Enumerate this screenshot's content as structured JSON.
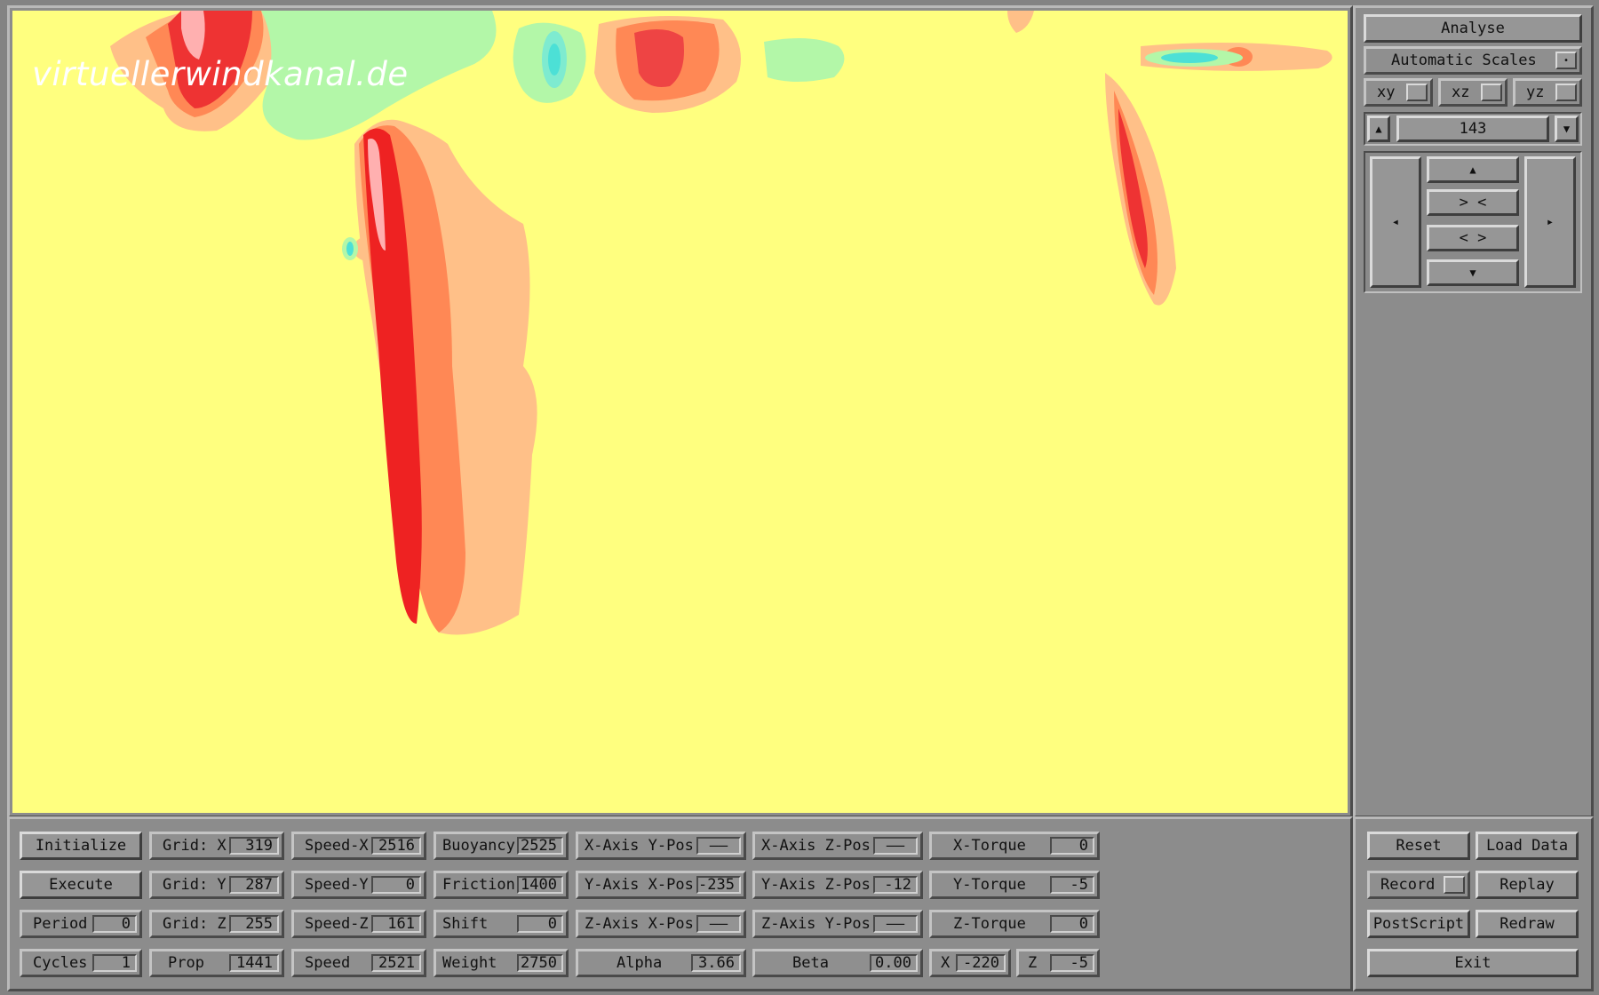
{
  "watermark": "virtuellerwindkanal.de",
  "side_panel": {
    "analyse_label": "Analyse",
    "scales_label": "Automatic Scales",
    "scales_check": "•",
    "plane_buttons": [
      "xy",
      "xz",
      "yz"
    ],
    "slice_up_glyph": "▲",
    "slice_down_glyph": "▼",
    "slice_value": "143",
    "nav": {
      "left_glyph": "◂",
      "right_glyph": "▸",
      "up_glyph": "▲",
      "zoom_in_label": "> <",
      "zoom_out_label": "< >",
      "down_glyph": "▼"
    }
  },
  "controls": {
    "initialize": "Initialize",
    "execute": "Execute",
    "period_label": "Period",
    "period_value": "0",
    "cycles_label": "Cycles",
    "cycles_value": "1",
    "grid_x_label": "Grid: X",
    "grid_x_value": "319",
    "grid_y_label": "Grid: Y",
    "grid_y_value": "287",
    "grid_z_label": "Grid: Z",
    "grid_z_value": "255",
    "prop_label": "Prop",
    "prop_value": "1441",
    "speed_x_label": "Speed-X",
    "speed_x_value": "2516",
    "speed_y_label": "Speed-Y",
    "speed_y_value": "0",
    "speed_z_label": "Speed-Z",
    "speed_z_value": "161",
    "speed_label": "Speed",
    "speed_value": "2521",
    "buoyancy_label": "Buoyancy",
    "buoyancy_value": "2525",
    "friction_label": "Friction",
    "friction_value": "1400",
    "shift_label": "Shift",
    "shift_value": "0",
    "weight_label": "Weight",
    "weight_value": "2750",
    "xaxis_ypos_label": "X-Axis Y-Pos",
    "xaxis_ypos_value": "——",
    "yaxis_xpos_label": "Y-Axis X-Pos",
    "yaxis_xpos_value": "-235",
    "zaxis_xpos_label": "Z-Axis X-Pos",
    "zaxis_xpos_value": "——",
    "alpha_label": "Alpha",
    "alpha_value": "3.66",
    "xaxis_zpos_label": "X-Axis Z-Pos",
    "xaxis_zpos_value": "——",
    "yaxis_zpos_label": "Y-Axis Z-Pos",
    "yaxis_zpos_value": "-12",
    "zaxis_ypos_label": "Z-Axis Y-Pos",
    "zaxis_ypos_value": "——",
    "beta_label": "Beta",
    "beta_value": "0.00",
    "x_torque_label": "X-Torque",
    "x_torque_value": "0",
    "y_torque_label": "Y-Torque",
    "y_torque_value": "-5",
    "z_torque_label": "Z-Torque",
    "z_torque_value": "0",
    "x_label": "X",
    "x_value": "-220",
    "z_label": "Z",
    "z_value": "-5"
  },
  "actions": {
    "reset": "Reset",
    "load_data": "Load Data",
    "record": "Record",
    "replay": "Replay",
    "postscript": "PostScript",
    "redraw": "Redraw",
    "exit": "Exit"
  },
  "colors": {
    "background": "#ffff7f",
    "red": "#ee2222",
    "orange": "#ff8855",
    "green": "#b3f7a8",
    "cyan": "#4ce0d6"
  }
}
